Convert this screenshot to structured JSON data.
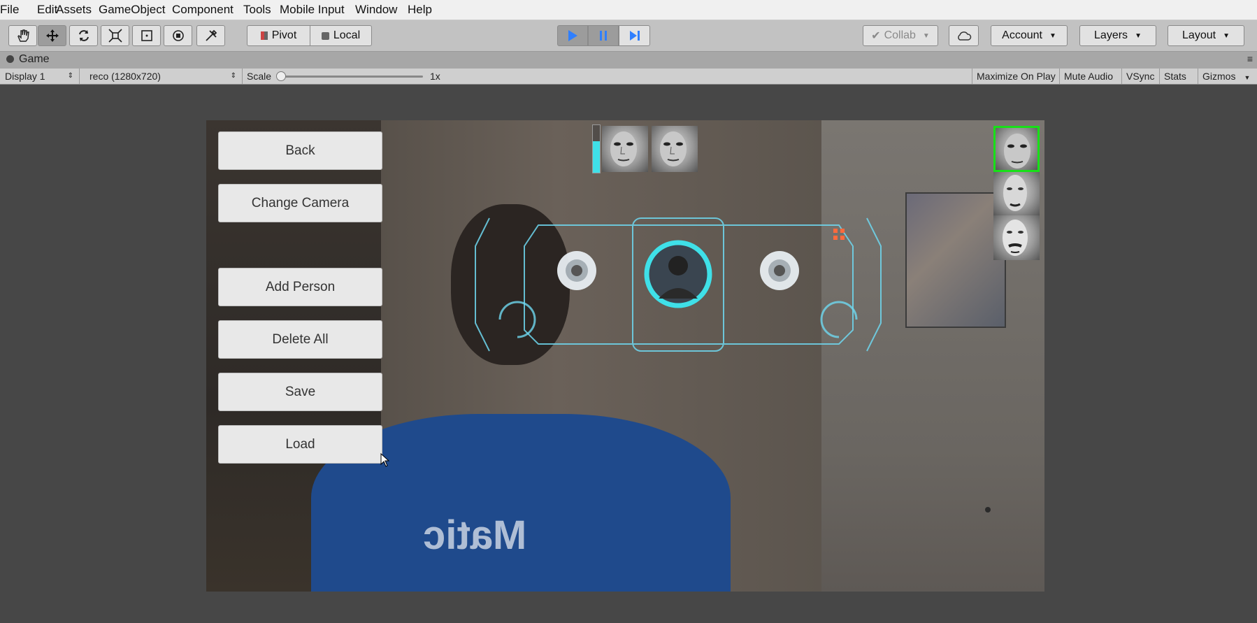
{
  "menu": [
    "File",
    "Edit",
    "Assets",
    "GameObject",
    "Component",
    "Tools",
    "Mobile Input",
    "Window",
    "Help"
  ],
  "toolbar": {
    "tools": [
      "hand-icon",
      "move-icon",
      "rotate-icon",
      "scale-icon",
      "rect-icon",
      "transform-icon",
      "custom-tool-icon"
    ],
    "pivot_label": "Pivot",
    "local_label": "Local",
    "collab_label": "Collab",
    "account_label": "Account",
    "layers_label": "Layers",
    "layout_label": "Layout"
  },
  "tab": {
    "label": "Game"
  },
  "gamebar": {
    "display": "Display 1",
    "resolution": "reco (1280x720)",
    "scale_label": "Scale",
    "scale_value": "1x",
    "maximize": "Maximize On Play",
    "mute": "Mute Audio",
    "vsync": "VSync",
    "stats": "Stats",
    "gizmos": "Gizmos"
  },
  "game_ui": {
    "buttons": {
      "back": "Back",
      "change_camera": "Change Camera",
      "add_person": "Add Person",
      "delete_all": "Delete All",
      "save": "Save",
      "load": "Load"
    },
    "shirt_text": "Matic"
  },
  "colors": {
    "accent": "#2f7fff",
    "hud_cyan": "#3fe0e8",
    "face_highlight": "#18e018"
  }
}
